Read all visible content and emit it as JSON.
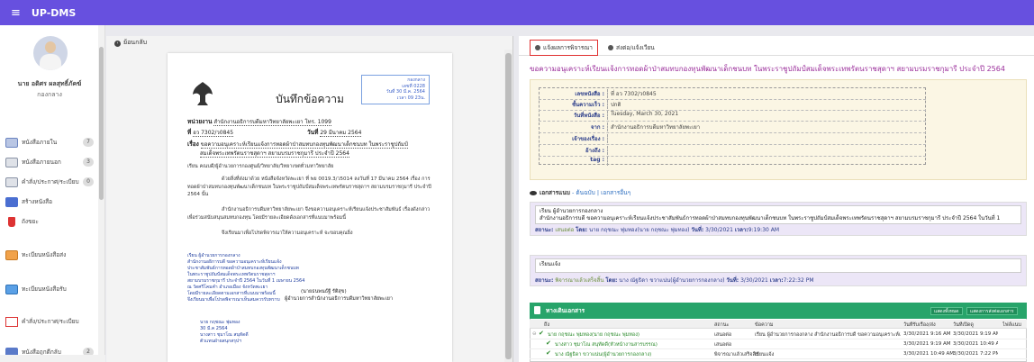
{
  "app": {
    "menu_icon": "≡",
    "title": "UP-DMS"
  },
  "user": {
    "name": "นาย อดิศร ผลสุทธิ์ภัคฆ์",
    "department": "กองกลาง"
  },
  "sidebar": {
    "items": [
      {
        "label": "หนังสือภายใน",
        "count": "7",
        "icon": "inbox-icon"
      },
      {
        "label": "หนังสือภายนอก",
        "count": "3",
        "icon": "external-mail-icon"
      },
      {
        "label": "คำสั่ง/ประกาศ/ระเบียบ",
        "count": "0",
        "icon": "announcement-icon"
      },
      {
        "label": "สร้างหนังสือ",
        "icon": "create-doc-icon"
      },
      {
        "label": "ถังขยะ",
        "icon": "trash-icon"
      },
      {
        "label": "ทะเบียนหนังสือส่ง",
        "icon": "sent-register-icon"
      },
      {
        "label": "ทะเบียนหนังสือรับ",
        "icon": "received-register-icon"
      },
      {
        "label": "คำสั่ง/ประกาศ/ระเบียบ",
        "icon": "order-register-icon"
      },
      {
        "label": "หนังสือถูกตีกลับ",
        "count": "2",
        "icon": "returned-doc-icon"
      }
    ]
  },
  "left": {
    "back_label": "ย้อนกลับ"
  },
  "memo": {
    "stamp": [
      "กองกลาง",
      "เลขที่ 0228",
      "วันที่ 30 มี.ค. 2564",
      "เวลา 09 23น."
    ],
    "title": "บันทึกข้อความ",
    "agency_label": "หน่วยงาน",
    "agency": "สำนักงานอธิการบดีมหาวิทยาลัยพะเยา  โทร. 1099",
    "no_label": "ที่",
    "no": "อว 7302/ว0845",
    "date_label": "วันที่",
    "date": "29  มีนาคม  2564",
    "subject_label": "เรื่อง",
    "subject": "ขอความอนุเคราะห์เรียนแจ้งการทอดผ้าป่าสมทบกองทุนพัฒนาเด็กชนบท ในพระราชูปถัมป์",
    "subject2": "สมเด็จพระเทพรัตนราชสุดาฯ สยามบรมราชกุมารี ประจำปี 2564",
    "to": "เรียน  คณบดี/ผู้อำนวยการกองศูนย์/วิทยาลัย/วิทยาเขตทั่วมหาวิทยาลัย",
    "p1": "ด้วยสิ่งที่ส่งมาด้วย หนังสือจังหวัดพะเยา ที่ พย 0019.3/ว5014 ลงวันที่ 17 มีนาคม 2564 เรื่อง การทอดผ้าป่าสมทบกองทุนพัฒนาเด็กชนบท ในพระราชูปถัมป์สมเด็จพระเทพรัตนราชสุดาฯ สยามบรมราชกุมารี ประจำปี 2564 นั้น",
    "p2": "สำนักงานอธิการบดีมหาวิทยาลัยพะเยา จึงขอความอนุเคราะห์เรียนแจ้งประชาสัมพันธ์ เรื่องดังกล่าว เพื่อร่วมสนับสนุนสมทบกองทุน โดยมีรายละเอียดดังเอกสารที่แนบมาพร้อมนี้",
    "p3": "จึงเรียนมาเพื่อโปรดพิจารณาให้ความอนุเคราะห์ จะขอบคุณยิ่ง",
    "hand": [
      "เรียน ผู้อำนวยการกองกลาง",
      "สำนักงานอธิการบดี ขอความอนุเคราะห์เรียนแจ้ง",
      "ประชาสัมพันธ์การทอดผ้าป่าสมทบกองทุนพัฒนาเด็กชนบท",
      "ในพระราชูปถัมป์สมเด็จพระเทพรัตนราชสุดาฯ",
      "สยามบรมราชกุมารี ประจำปี 2564 ในวันที่ 1 เมษายน 2564",
      "ณ วัดศรีโคมคำ อำเภอเมือง จังหวัดพะเยา",
      "โดยมีรายละเอียดตามเอกสารที่แนบมาพร้อมนี้",
      "จึงเรียนมาเพื่อโปรดพิจารณาเห็นสมควรรับทราบ"
    ],
    "signer": "(นายธนพนธ์ฐี รัติสุข)",
    "signer_pos": "ผู้อำนวยการสำนักงานอธิการบดีมหาวิทยาลัยพะเยา",
    "hand2": [
      "นาย กฤชณะ พุ่มทอง",
      "30 มี.ค 2564",
      "นางสาว ชุมาโณ สนุทัดดี",
      "ตัวแทนฝ่ายสนุกสรุปฯ"
    ]
  },
  "tabs": [
    {
      "label": "แจ้งผลการพิจารณา",
      "icon": "user-icon"
    },
    {
      "label": "ส่งต่อ/แจ้งเวียน",
      "icon": "user-icon"
    }
  ],
  "detail": {
    "title": "ขอความอนุเคราะห์เรียนแจ้งการทอดผ้าป่าสมทบกองทุนพัฒนาเด็กชนบท ในพระราชูปถัมป์สมเด็จพระเทพรัตนราชสุดาฯ สยามบรมราชกุมารี ประจำปี 2564",
    "rows": [
      {
        "k": "เลขหนังสือ :",
        "v": "ที่ อว 7302/ว0845"
      },
      {
        "k": "ชั้นความเร็ว :",
        "v": "ปกติ"
      },
      {
        "k": "วันที่หนังสือ :",
        "v": "Tuesday, March 30, 2021"
      },
      {
        "k": "จาก :",
        "v": "สำนักงานอธิการบดีมหาวิทยาลัยพะเยา"
      },
      {
        "k": "เจ้าของเรื่อง :",
        "v": ""
      },
      {
        "k": "อ้างถึง :",
        "v": ""
      },
      {
        "k": "tag :",
        "v": ""
      }
    ],
    "attach_label": "เอกสารแนบ",
    "attach_links": "- ต้นฉบับ | เอกสารอื่นๆ"
  },
  "note1": {
    "line1": "เรียน ผู้อำนวยการกองกลาง",
    "line2": "      สำนักงานอธิการบดี ขอความอนุเคราะห์เรียนแจ้งประชาสัมพันธ์การทอดผ้าป่าสมทบกองทุนพัฒนาเด็กชนบท ในพระราชูปถัมป์สมเด็จพระเทพรัตนราชสุดาฯ สยามบรมราชกุมารี ประจำปี 2564 ในวันที่ 1",
    "status_label": "สถานะ:",
    "status": "เสนอต่อ",
    "by_label": "โดย:",
    "by": "นาย กฤชณะ พุ่มทอง(นาย กฤชณะ พุ่มทอง)",
    "date_label": "วันที่:",
    "date": "3/30/2021",
    "time_label": "เวลา:",
    "time": "9:19:30 AM"
  },
  "note2": {
    "line1": "เรียนแจ้ง",
    "status_label": "สถานะ:",
    "status": "พิจารณาแล้วเสร็จสิ้น",
    "by_label": "โดย:",
    "by": "นาง ณัฐธิดา ขวาแน่น(ผู้อำนวยการกองกลาง)",
    "date_label": "วันที่:",
    "date": "3/30/2021",
    "time_label": "เวลา:",
    "time": "7:22:32 PM"
  },
  "flow": {
    "title": "ทางเดินเอกสาร",
    "btn1": "แสดงทั้งหมด",
    "btn2": "แสดงการส่งต่อเอกสาร",
    "headers": [
      "ถึง",
      "สถานะ",
      "ข้อความ",
      "วันที่รับเรื่อง/ส่ง",
      "วันที่เปิดดู",
      "ไฟล์แนบ"
    ],
    "rows": [
      {
        "to": "นาย กฤชณะ พุ่มทอง(นาย กฤชณะ พุ่มทอง)",
        "status": "เสนอต่อ",
        "msg": "เรียน ผู้อำนวยการกองกลาง สำนักงานอธิการบดี ขอความอนุเคราะห์เรียนแจ้ง",
        "sent": "3/30/2021 9:16 AM",
        "opened": "3/30/2021 9:19 AM"
      },
      {
        "to": "นางสาว ชุมาโณ สนุทัดดี(หัวหน้างานสารบรรณ)",
        "status": "เสนอต่อ",
        "msg": "",
        "sent": "3/30/2021 9:19 AM",
        "opened": "3/30/2021 10:49 AM"
      },
      {
        "to": "นาง ณัฐธิดา ขวาแน่น(ผู้อำนวยการกองกลาง)",
        "status": "พิจารณาแล้วเสร็จสิ้น",
        "msg": "เรียนแจ้ง",
        "sent": "3/30/2021 10:49 AM",
        "opened": "3/30/2021 7:22 PM"
      }
    ]
  }
}
